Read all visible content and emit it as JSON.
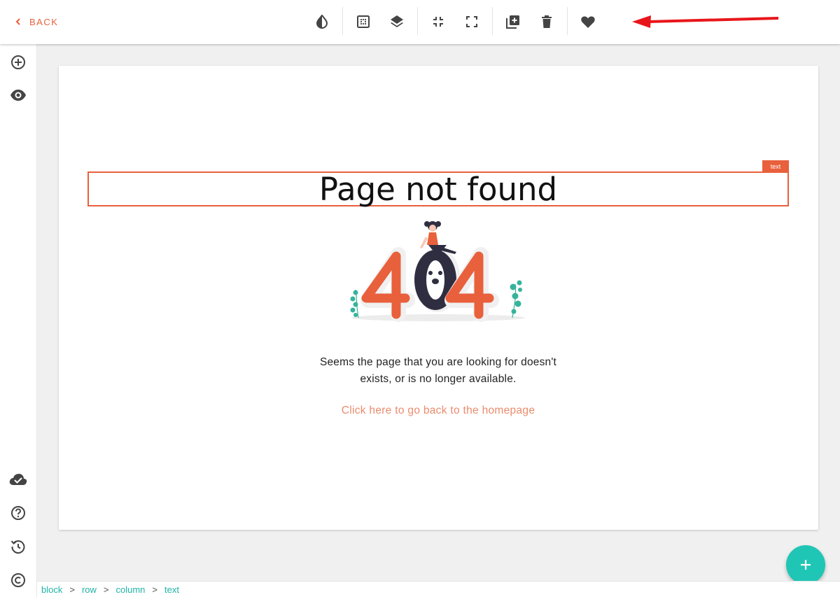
{
  "topbar": {
    "back_label": "BACK",
    "tools": [
      {
        "name": "contrast-icon"
      },
      {
        "name": "grid-icon"
      },
      {
        "name": "layers-icon"
      },
      {
        "name": "collapse-icon"
      },
      {
        "name": "fullscreen-icon"
      },
      {
        "name": "duplicate-icon"
      },
      {
        "name": "delete-icon"
      },
      {
        "name": "favorite-icon"
      }
    ]
  },
  "sidebar": {
    "top_items": [
      {
        "name": "add-icon"
      },
      {
        "name": "preview-icon"
      }
    ],
    "bottom_items": [
      {
        "name": "cloud-done-icon"
      },
      {
        "name": "help-icon"
      },
      {
        "name": "history-icon"
      },
      {
        "name": "copyright-icon"
      }
    ]
  },
  "canvas": {
    "selection_tag": "text",
    "title": "Page not found",
    "description_line1": "Seems the page that you are looking for doesn't",
    "description_line2": "exists, or is no longer available.",
    "link_text": "Click here to go back to the homepage"
  },
  "breadcrumb": {
    "items": [
      "block",
      "row",
      "column",
      "text"
    ],
    "separator": ">"
  },
  "colors": {
    "accent": "#e8603c",
    "teal": "#1fc6b5",
    "link": "#eb8b6c",
    "icon": "#444444"
  }
}
